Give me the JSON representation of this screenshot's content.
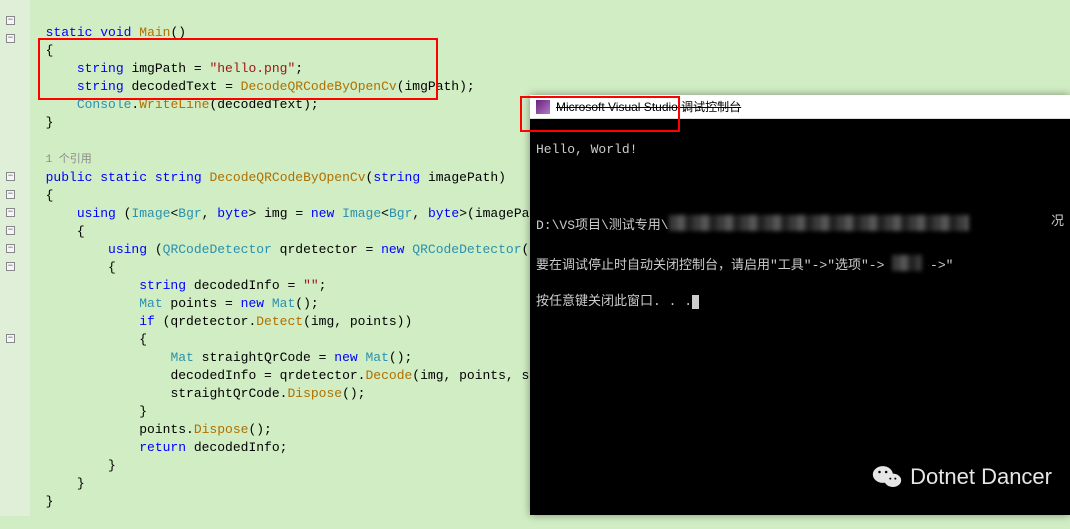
{
  "code": {
    "mainSig": {
      "kw1": "static",
      "kw2": "void",
      "name": "Main",
      "paren": "()"
    },
    "braceOpen": "{",
    "braceClose": "}",
    "line1": {
      "kw": "string",
      "var": "imgPath",
      "eq": " = ",
      "str": "\"hello.png\"",
      "end": ";"
    },
    "line2": {
      "kw": "string",
      "var": "decodedText",
      "eq": " = ",
      "method": "DecodeQRCodeByOpenCv",
      "args": "(imgPath);"
    },
    "line3": {
      "cls": "Console",
      "dot": ".",
      "method": "WriteLine",
      "args": "(decodedText);"
    },
    "refCount": "1 个引用",
    "decodeSig": {
      "kw1": "public",
      "kw2": "static",
      "kw3": "string",
      "name": "DecodeQRCodeByOpenCv",
      "paren1": "(",
      "argkw": "string",
      "argname": "imagePath",
      "paren2": ")"
    },
    "using1": {
      "kw": "using",
      "p1": " (",
      "type1": "Image",
      "gen": "<",
      "type2": "Bgr",
      "comma": ", ",
      "type3": "byte",
      "gen2": ">",
      "var": " img = ",
      "newkw": "new",
      "sp": " ",
      "type4": "Image",
      "gen3": "<",
      "type5": "Bgr",
      "comma2": ", ",
      "type6": "byte",
      "gen4": ">",
      "args": "(imagePath))"
    },
    "using2": {
      "kw": "using",
      "p1": " (",
      "type1": "QRCodeDetector",
      "var": " qrdetector = ",
      "newkw": "new",
      "sp": " ",
      "type2": "QRCodeDetector",
      "args": "())"
    },
    "decl1": {
      "kw": "string",
      "var": " decodedInfo = ",
      "str": "\"\"",
      "end": ";"
    },
    "decl2": {
      "type": "Mat",
      "var": " points = ",
      "newkw": "new",
      "sp": " ",
      "type2": "Mat",
      "args": "();"
    },
    "if1": {
      "kw": "if",
      "p1": " (qrdetector.",
      "method": "Detect",
      "args": "(img, points))"
    },
    "decl3": {
      "type": "Mat",
      "var": " straightQrCode = ",
      "newkw": "new",
      "sp": " ",
      "type2": "Mat",
      "args": "();"
    },
    "assign1": {
      "lhs": "decodedInfo = qrdetector.",
      "method": "Decode",
      "args": "(img, points, straightQrCode);"
    },
    "call1": {
      "lhs": "straightQrCode.",
      "method": "Dispose",
      "args": "();"
    },
    "call2": {
      "lhs": "points.",
      "method": "Dispose",
      "args": "();"
    },
    "ret": {
      "kw": "return",
      "var": " decodedInfo;"
    }
  },
  "console": {
    "title": "Microsoft Visual Studio 调试控制台",
    "output": "Hello, World!",
    "path": "D:\\VS项目\\测试专用\\",
    "msg1a": "要在调试停止时自动关闭控制台，请启用\"工具\"->\"选项\"->",
    "msg1b": "调试",
    "msg1c": "->\"",
    "msg2": "按任意键关闭此窗口. . .",
    "tailchar": "况"
  },
  "watermark": {
    "text": "Dotnet Dancer"
  }
}
